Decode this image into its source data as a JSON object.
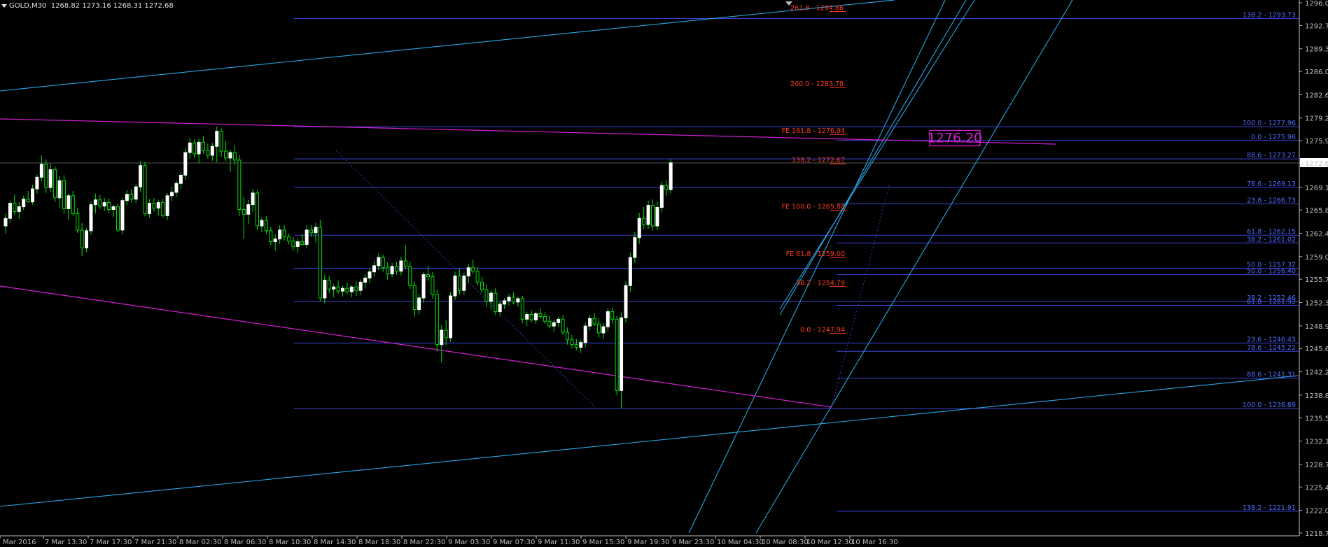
{
  "header": {
    "symbol": "GOLD,M30",
    "ohlc": "1268.82 1273.16 1268.31 1272.68"
  },
  "price_axis": {
    "labels": [
      "1296.03",
      "1292.73",
      "1289.33",
      "1286.03",
      "1282.63",
      "1279.23",
      "1275.93",
      "1272.68",
      "1269.13",
      "1265.83",
      "1262.43",
      "1259.03",
      "1255.73",
      "1252.33",
      "1248.93",
      "1245.63",
      "1242.23",
      "1238.83",
      "1235.53",
      "1232.13",
      "1228.73",
      "1225.43",
      "1222.03",
      "1218.73"
    ],
    "current_price": "1272.68"
  },
  "time_axis": {
    "labels": [
      "Mar 2016",
      "7 Mar 13:30",
      "7 Mar 17:30",
      "7 Mar 21:30",
      "8 Mar 02:30",
      "8 Mar 06:30",
      "8 Mar 10:30",
      "8 Mar 14:30",
      "8 Mar 18:30",
      "8 Mar 22:30",
      "9 Mar 03:30",
      "9 Mar 07:30",
      "9 Mar 11:30",
      "9 Mar 15:30",
      "9 Mar 19:30",
      "9 Mar 23:30",
      "10 Mar 04:30",
      "10 Mar 08:30",
      "10 Mar 12:30",
      "10 Mar 16:30"
    ]
  },
  "fib_right_labels": [
    "138.2 - 1293.73",
    "100.0 - 1277.96",
    "0.0 - 1275.96",
    "88.6 - 1273.27",
    "78.6 - 1269.13",
    "23.6 - 1266.73",
    "61.8 - 1262.15",
    "38.2 - 1261.02",
    "50.0 - 1257.32",
    "50.0 - 1256.40",
    "38.2 - 1252.46",
    "61.8 - 1251.92",
    "23.6 - 1246.43",
    "78.6 - 1245.22",
    "88.6 - 1241.31",
    "100.0 - 1236.89",
    "138.2 - 1221.91"
  ],
  "fe_labels": [
    "261.8 - 1294.86",
    "200.0 - 1283.78",
    "FE 161.8 - 1276.94",
    "138.2 - 1272.67",
    "FE 100.0 - 1265.88",
    "FE 61.8 - 1259.00",
    "38.2 - 1254.79",
    "0.0 - 1247.94"
  ],
  "price_box": {
    "label": "1276.20"
  },
  "colors": {
    "background": "#000000",
    "fib_line": "#3a44d6",
    "fib_text": "#4f6bff",
    "fe_text": "#ff3b1f",
    "trend": "#27a6e6",
    "magenta": "#d21fd2",
    "bull_candle": "#ffffff",
    "bear_candle": "#00e000",
    "axis": "#c0c0c0"
  },
  "candles": [
    {
      "o": 1263.5,
      "h": 1265.3,
      "l": 1262.4,
      "c": 1264.6
    },
    {
      "o": 1264.6,
      "h": 1267.2,
      "l": 1264.0,
      "c": 1266.8
    },
    {
      "o": 1266.8,
      "h": 1268.1,
      "l": 1265.1,
      "c": 1265.6
    },
    {
      "o": 1265.6,
      "h": 1267.0,
      "l": 1264.5,
      "c": 1266.3
    },
    {
      "o": 1266.3,
      "h": 1267.9,
      "l": 1265.8,
      "c": 1267.4
    },
    {
      "o": 1267.4,
      "h": 1268.6,
      "l": 1266.9,
      "c": 1267.0
    },
    {
      "o": 1267.0,
      "h": 1269.5,
      "l": 1266.6,
      "c": 1268.9
    },
    {
      "o": 1268.9,
      "h": 1271.0,
      "l": 1268.2,
      "c": 1270.6
    },
    {
      "o": 1270.6,
      "h": 1273.8,
      "l": 1270.0,
      "c": 1272.5
    },
    {
      "o": 1272.5,
      "h": 1273.2,
      "l": 1268.3,
      "c": 1269.1
    },
    {
      "o": 1269.1,
      "h": 1272.6,
      "l": 1268.5,
      "c": 1271.7
    },
    {
      "o": 1271.7,
      "h": 1272.2,
      "l": 1267.0,
      "c": 1267.6
    },
    {
      "o": 1267.6,
      "h": 1270.8,
      "l": 1266.1,
      "c": 1270.1
    },
    {
      "o": 1270.1,
      "h": 1270.9,
      "l": 1265.3,
      "c": 1266.0
    },
    {
      "o": 1266.0,
      "h": 1268.3,
      "l": 1264.4,
      "c": 1267.9
    },
    {
      "o": 1267.9,
      "h": 1268.6,
      "l": 1264.9,
      "c": 1265.3
    },
    {
      "o": 1265.3,
      "h": 1266.1,
      "l": 1262.5,
      "c": 1262.9
    },
    {
      "o": 1262.9,
      "h": 1263.9,
      "l": 1259.1,
      "c": 1260.3
    },
    {
      "o": 1260.3,
      "h": 1263.2,
      "l": 1259.7,
      "c": 1262.8
    },
    {
      "o": 1262.8,
      "h": 1267.1,
      "l": 1262.2,
      "c": 1266.6
    },
    {
      "o": 1266.6,
      "h": 1268.2,
      "l": 1265.3,
      "c": 1267.3
    },
    {
      "o": 1267.3,
      "h": 1268.0,
      "l": 1266.0,
      "c": 1266.4
    },
    {
      "o": 1266.4,
      "h": 1267.6,
      "l": 1265.7,
      "c": 1266.9
    },
    {
      "o": 1266.9,
      "h": 1267.5,
      "l": 1265.4,
      "c": 1265.9
    },
    {
      "o": 1265.9,
      "h": 1266.6,
      "l": 1264.8,
      "c": 1266.3
    },
    {
      "o": 1266.3,
      "h": 1266.8,
      "l": 1262.6,
      "c": 1262.9
    },
    {
      "o": 1262.9,
      "h": 1267.6,
      "l": 1262.3,
      "c": 1267.2
    },
    {
      "o": 1267.2,
      "h": 1268.7,
      "l": 1266.5,
      "c": 1268.1
    },
    {
      "o": 1268.1,
      "h": 1268.9,
      "l": 1266.9,
      "c": 1267.4
    },
    {
      "o": 1267.4,
      "h": 1269.6,
      "l": 1266.8,
      "c": 1269.2
    },
    {
      "o": 1269.2,
      "h": 1272.9,
      "l": 1268.5,
      "c": 1272.3
    },
    {
      "o": 1272.3,
      "h": 1272.8,
      "l": 1264.9,
      "c": 1265.3
    },
    {
      "o": 1265.3,
      "h": 1267.4,
      "l": 1264.7,
      "c": 1266.8
    },
    {
      "o": 1266.8,
      "h": 1267.6,
      "l": 1265.6,
      "c": 1266.1
    },
    {
      "o": 1266.1,
      "h": 1267.3,
      "l": 1265.0,
      "c": 1266.9
    },
    {
      "o": 1266.9,
      "h": 1267.4,
      "l": 1264.7,
      "c": 1265.0
    },
    {
      "o": 1265.0,
      "h": 1268.3,
      "l": 1264.4,
      "c": 1267.9
    },
    {
      "o": 1267.9,
      "h": 1269.2,
      "l": 1267.1,
      "c": 1268.4
    },
    {
      "o": 1268.4,
      "h": 1270.1,
      "l": 1267.7,
      "c": 1269.7
    },
    {
      "o": 1269.7,
      "h": 1271.3,
      "l": 1268.9,
      "c": 1270.9
    },
    {
      "o": 1270.9,
      "h": 1274.9,
      "l": 1270.2,
      "c": 1274.2
    },
    {
      "o": 1274.2,
      "h": 1276.3,
      "l": 1273.3,
      "c": 1275.6
    },
    {
      "o": 1275.6,
      "h": 1276.2,
      "l": 1273.4,
      "c": 1274.0
    },
    {
      "o": 1274.0,
      "h": 1276.2,
      "l": 1272.6,
      "c": 1275.7
    },
    {
      "o": 1275.7,
      "h": 1276.6,
      "l": 1274.0,
      "c": 1274.5
    },
    {
      "o": 1274.5,
      "h": 1275.5,
      "l": 1273.3,
      "c": 1273.8
    },
    {
      "o": 1273.8,
      "h": 1275.6,
      "l": 1273.0,
      "c": 1275.1
    },
    {
      "o": 1275.1,
      "h": 1278.0,
      "l": 1272.8,
      "c": 1277.3
    },
    {
      "o": 1277.3,
      "h": 1277.7,
      "l": 1273.6,
      "c": 1274.4
    },
    {
      "o": 1274.4,
      "h": 1275.9,
      "l": 1272.9,
      "c": 1273.4
    },
    {
      "o": 1273.4,
      "h": 1274.6,
      "l": 1271.4,
      "c": 1274.2
    },
    {
      "o": 1274.2,
      "h": 1275.3,
      "l": 1272.4,
      "c": 1273.1
    },
    {
      "o": 1273.1,
      "h": 1273.8,
      "l": 1264.9,
      "c": 1265.9
    },
    {
      "o": 1265.9,
      "h": 1267.7,
      "l": 1261.6,
      "c": 1265.2
    },
    {
      "o": 1265.2,
      "h": 1267.3,
      "l": 1263.8,
      "c": 1266.6
    },
    {
      "o": 1266.6,
      "h": 1268.9,
      "l": 1265.6,
      "c": 1268.3
    },
    {
      "o": 1268.3,
      "h": 1268.7,
      "l": 1262.9,
      "c": 1263.5
    },
    {
      "o": 1263.5,
      "h": 1264.8,
      "l": 1262.6,
      "c": 1264.3
    },
    {
      "o": 1264.3,
      "h": 1264.9,
      "l": 1262.3,
      "c": 1262.8
    },
    {
      "o": 1262.8,
      "h": 1263.4,
      "l": 1260.7,
      "c": 1261.2
    },
    {
      "o": 1261.2,
      "h": 1262.3,
      "l": 1259.9,
      "c": 1261.6
    },
    {
      "o": 1261.6,
      "h": 1263.6,
      "l": 1260.9,
      "c": 1262.9
    },
    {
      "o": 1262.9,
      "h": 1263.6,
      "l": 1261.4,
      "c": 1261.9
    },
    {
      "o": 1261.9,
      "h": 1262.4,
      "l": 1260.8,
      "c": 1261.3
    },
    {
      "o": 1261.3,
      "h": 1261.9,
      "l": 1259.9,
      "c": 1260.5
    },
    {
      "o": 1260.5,
      "h": 1261.7,
      "l": 1259.5,
      "c": 1261.2
    },
    {
      "o": 1261.2,
      "h": 1262.3,
      "l": 1260.6,
      "c": 1260.8
    },
    {
      "o": 1260.8,
      "h": 1263.6,
      "l": 1260.2,
      "c": 1262.9
    },
    {
      "o": 1262.9,
      "h": 1263.6,
      "l": 1261.9,
      "c": 1262.5
    },
    {
      "o": 1262.5,
      "h": 1263.9,
      "l": 1261.1,
      "c": 1263.3
    },
    {
      "o": 1263.3,
      "h": 1264.4,
      "l": 1252.5,
      "c": 1253.0
    },
    {
      "o": 1253.0,
      "h": 1256.4,
      "l": 1252.2,
      "c": 1255.6
    },
    {
      "o": 1255.6,
      "h": 1256.2,
      "l": 1253.7,
      "c": 1254.3
    },
    {
      "o": 1254.3,
      "h": 1255.0,
      "l": 1253.1,
      "c": 1254.6
    },
    {
      "o": 1254.6,
      "h": 1255.5,
      "l": 1253.6,
      "c": 1254.0
    },
    {
      "o": 1254.0,
      "h": 1254.8,
      "l": 1253.2,
      "c": 1254.4
    },
    {
      "o": 1254.4,
      "h": 1255.3,
      "l": 1253.5,
      "c": 1253.9
    },
    {
      "o": 1253.9,
      "h": 1254.9,
      "l": 1253.1,
      "c": 1254.6
    },
    {
      "o": 1254.6,
      "h": 1255.4,
      "l": 1253.3,
      "c": 1254.1
    },
    {
      "o": 1254.1,
      "h": 1255.7,
      "l": 1253.4,
      "c": 1255.3
    },
    {
      "o": 1255.3,
      "h": 1256.5,
      "l": 1254.4,
      "c": 1255.9
    },
    {
      "o": 1255.9,
      "h": 1257.3,
      "l": 1255.2,
      "c": 1256.8
    },
    {
      "o": 1256.8,
      "h": 1258.4,
      "l": 1256.1,
      "c": 1257.7
    },
    {
      "o": 1257.7,
      "h": 1259.5,
      "l": 1257.0,
      "c": 1258.9
    },
    {
      "o": 1258.9,
      "h": 1259.3,
      "l": 1256.8,
      "c": 1257.4
    },
    {
      "o": 1257.4,
      "h": 1258.2,
      "l": 1255.6,
      "c": 1256.5
    },
    {
      "o": 1256.5,
      "h": 1258.1,
      "l": 1256.0,
      "c": 1257.6
    },
    {
      "o": 1257.6,
      "h": 1258.3,
      "l": 1256.4,
      "c": 1256.9
    },
    {
      "o": 1256.9,
      "h": 1259.0,
      "l": 1256.3,
      "c": 1258.4
    },
    {
      "o": 1258.4,
      "h": 1260.7,
      "l": 1257.2,
      "c": 1257.6
    },
    {
      "o": 1257.6,
      "h": 1258.3,
      "l": 1254.3,
      "c": 1254.8
    },
    {
      "o": 1254.8,
      "h": 1255.4,
      "l": 1250.2,
      "c": 1251.3
    },
    {
      "o": 1251.3,
      "h": 1253.5,
      "l": 1250.6,
      "c": 1253.0
    },
    {
      "o": 1253.0,
      "h": 1256.8,
      "l": 1252.3,
      "c": 1256.4
    },
    {
      "o": 1256.4,
      "h": 1257.7,
      "l": 1255.5,
      "c": 1256.1
    },
    {
      "o": 1256.1,
      "h": 1256.8,
      "l": 1252.9,
      "c": 1253.5
    },
    {
      "o": 1253.5,
      "h": 1254.2,
      "l": 1245.2,
      "c": 1246.2
    },
    {
      "o": 1246.2,
      "h": 1249.0,
      "l": 1243.6,
      "c": 1248.3
    },
    {
      "o": 1248.3,
      "h": 1249.8,
      "l": 1246.1,
      "c": 1247.2
    },
    {
      "o": 1247.2,
      "h": 1253.9,
      "l": 1246.6,
      "c": 1253.3
    },
    {
      "o": 1253.3,
      "h": 1256.8,
      "l": 1252.7,
      "c": 1256.2
    },
    {
      "o": 1256.2,
      "h": 1257.3,
      "l": 1253.5,
      "c": 1254.1
    },
    {
      "o": 1254.1,
      "h": 1256.7,
      "l": 1253.4,
      "c": 1256.2
    },
    {
      "o": 1256.2,
      "h": 1258.0,
      "l": 1255.2,
      "c": 1257.4
    },
    {
      "o": 1257.4,
      "h": 1258.6,
      "l": 1256.5,
      "c": 1256.9
    },
    {
      "o": 1256.9,
      "h": 1257.5,
      "l": 1254.8,
      "c": 1255.3
    },
    {
      "o": 1255.3,
      "h": 1256.1,
      "l": 1253.7,
      "c": 1254.2
    },
    {
      "o": 1254.2,
      "h": 1255.0,
      "l": 1251.7,
      "c": 1252.5
    },
    {
      "o": 1252.5,
      "h": 1254.2,
      "l": 1251.3,
      "c": 1253.7
    },
    {
      "o": 1253.7,
      "h": 1254.4,
      "l": 1250.5,
      "c": 1251.0
    },
    {
      "o": 1251.0,
      "h": 1252.6,
      "l": 1250.3,
      "c": 1252.1
    },
    {
      "o": 1252.1,
      "h": 1253.0,
      "l": 1251.4,
      "c": 1252.6
    },
    {
      "o": 1252.6,
      "h": 1253.6,
      "l": 1251.9,
      "c": 1253.1
    },
    {
      "o": 1253.1,
      "h": 1253.8,
      "l": 1252.1,
      "c": 1252.4
    },
    {
      "o": 1252.4,
      "h": 1253.2,
      "l": 1251.7,
      "c": 1252.9
    },
    {
      "o": 1252.9,
      "h": 1253.3,
      "l": 1249.3,
      "c": 1249.9
    },
    {
      "o": 1249.9,
      "h": 1251.0,
      "l": 1248.9,
      "c": 1250.6
    },
    {
      "o": 1250.6,
      "h": 1251.2,
      "l": 1249.4,
      "c": 1249.8
    },
    {
      "o": 1249.8,
      "h": 1251.0,
      "l": 1249.2,
      "c": 1250.7
    },
    {
      "o": 1250.7,
      "h": 1251.5,
      "l": 1250.0,
      "c": 1250.3
    },
    {
      "o": 1250.3,
      "h": 1250.9,
      "l": 1249.2,
      "c": 1249.6
    },
    {
      "o": 1249.6,
      "h": 1250.4,
      "l": 1248.6,
      "c": 1248.9
    },
    {
      "o": 1248.9,
      "h": 1249.8,
      "l": 1248.1,
      "c": 1249.4
    },
    {
      "o": 1249.4,
      "h": 1250.3,
      "l": 1248.8,
      "c": 1249.9
    },
    {
      "o": 1249.9,
      "h": 1250.5,
      "l": 1247.6,
      "c": 1248.0
    },
    {
      "o": 1248.0,
      "h": 1248.7,
      "l": 1246.2,
      "c": 1246.9
    },
    {
      "o": 1246.9,
      "h": 1247.6,
      "l": 1245.6,
      "c": 1246.2
    },
    {
      "o": 1246.2,
      "h": 1247.0,
      "l": 1245.4,
      "c": 1245.8
    },
    {
      "o": 1245.8,
      "h": 1246.9,
      "l": 1245.0,
      "c": 1246.5
    },
    {
      "o": 1246.5,
      "h": 1249.4,
      "l": 1245.8,
      "c": 1248.9
    },
    {
      "o": 1248.9,
      "h": 1250.5,
      "l": 1248.3,
      "c": 1250.0
    },
    {
      "o": 1250.0,
      "h": 1250.8,
      "l": 1248.9,
      "c": 1249.2
    },
    {
      "o": 1249.2,
      "h": 1250.0,
      "l": 1247.2,
      "c": 1247.9
    },
    {
      "o": 1247.9,
      "h": 1249.3,
      "l": 1247.0,
      "c": 1248.8
    },
    {
      "o": 1248.8,
      "h": 1251.5,
      "l": 1248.1,
      "c": 1251.0
    },
    {
      "o": 1251.0,
      "h": 1251.6,
      "l": 1249.3,
      "c": 1249.9
    },
    {
      "o": 1249.9,
      "h": 1250.4,
      "l": 1238.8,
      "c": 1239.5
    },
    {
      "o": 1239.5,
      "h": 1250.9,
      "l": 1236.9,
      "c": 1250.1
    },
    {
      "o": 1250.1,
      "h": 1255.4,
      "l": 1249.4,
      "c": 1254.8
    },
    {
      "o": 1254.8,
      "h": 1259.6,
      "l": 1253.9,
      "c": 1258.9
    },
    {
      "o": 1258.9,
      "h": 1262.6,
      "l": 1258.1,
      "c": 1261.8
    },
    {
      "o": 1261.8,
      "h": 1265.4,
      "l": 1260.9,
      "c": 1264.6
    },
    {
      "o": 1264.6,
      "h": 1266.3,
      "l": 1263.0,
      "c": 1263.7
    },
    {
      "o": 1263.7,
      "h": 1267.2,
      "l": 1263.1,
      "c": 1266.5
    },
    {
      "o": 1266.5,
      "h": 1267.4,
      "l": 1262.8,
      "c": 1263.5
    },
    {
      "o": 1263.5,
      "h": 1267.0,
      "l": 1262.9,
      "c": 1266.2
    },
    {
      "o": 1266.2,
      "h": 1270.0,
      "l": 1265.5,
      "c": 1269.4
    },
    {
      "o": 1269.4,
      "h": 1270.2,
      "l": 1267.9,
      "c": 1268.8
    },
    {
      "o": 1268.8,
      "h": 1273.2,
      "l": 1268.3,
      "c": 1272.7
    }
  ]
}
